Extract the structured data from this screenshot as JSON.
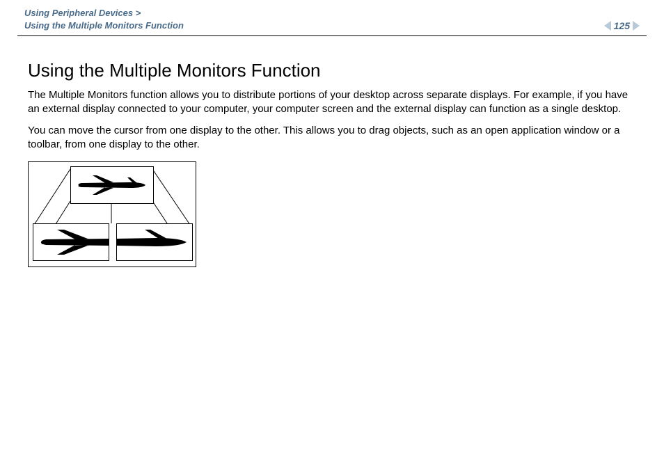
{
  "header": {
    "breadcrumb_section": "Using Peripheral Devices >",
    "breadcrumb_page": "Using the Multiple Monitors Function",
    "page_number": "125"
  },
  "content": {
    "title": "Using the Multiple Monitors Function",
    "para1": "The Multiple Monitors function allows you to distribute portions of your desktop across separate displays. For example, if you have an external display connected to your computer, your computer screen and the external display can function as a single desktop.",
    "para2": "You can move the cursor from one display to the other. This allows you to drag objects, such as an open application window or a toolbar, from one display to the other."
  },
  "figure": {
    "alt": "Diagram of one image of an airplane distributed across three separate monitor frames"
  }
}
